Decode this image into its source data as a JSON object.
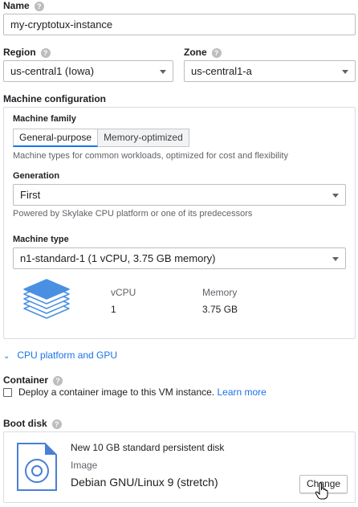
{
  "name": {
    "label": "Name",
    "value": "my-cryptotux-instance"
  },
  "region": {
    "label": "Region",
    "value": "us-central1 (Iowa)"
  },
  "zone": {
    "label": "Zone",
    "value": "us-central1-a"
  },
  "machine_config": {
    "label": "Machine configuration",
    "family_label": "Machine family",
    "tabs": [
      "General-purpose",
      "Memory-optimized"
    ],
    "active_tab": "General-purpose",
    "family_hint": "Machine types for common workloads, optimized for cost and flexibility",
    "generation_label": "Generation",
    "generation_value": "First",
    "generation_hint": "Powered by Skylake CPU platform or one of its predecessors",
    "machine_type_label": "Machine type",
    "machine_type_value": "n1-standard-1 (1 vCPU, 3.75 GB memory)",
    "specs": {
      "vcpu_label": "vCPU",
      "vcpu_value": "1",
      "memory_label": "Memory",
      "memory_value": "3.75 GB"
    }
  },
  "cpu_platform_link": "CPU platform and GPU",
  "container": {
    "label": "Container",
    "checkbox_text": "Deploy a container image to this VM instance.",
    "learn_more": "Learn more",
    "checked": false
  },
  "boot_disk": {
    "label": "Boot disk",
    "title": "New 10 GB standard persistent disk",
    "image_label": "Image",
    "image_value": "Debian GNU/Linux 9 (stretch)",
    "change_button": "Change"
  },
  "colors": {
    "accent": "#1a73e8",
    "stack_icon": "#4a90e2",
    "disk_icon": "#4a7fd6"
  }
}
